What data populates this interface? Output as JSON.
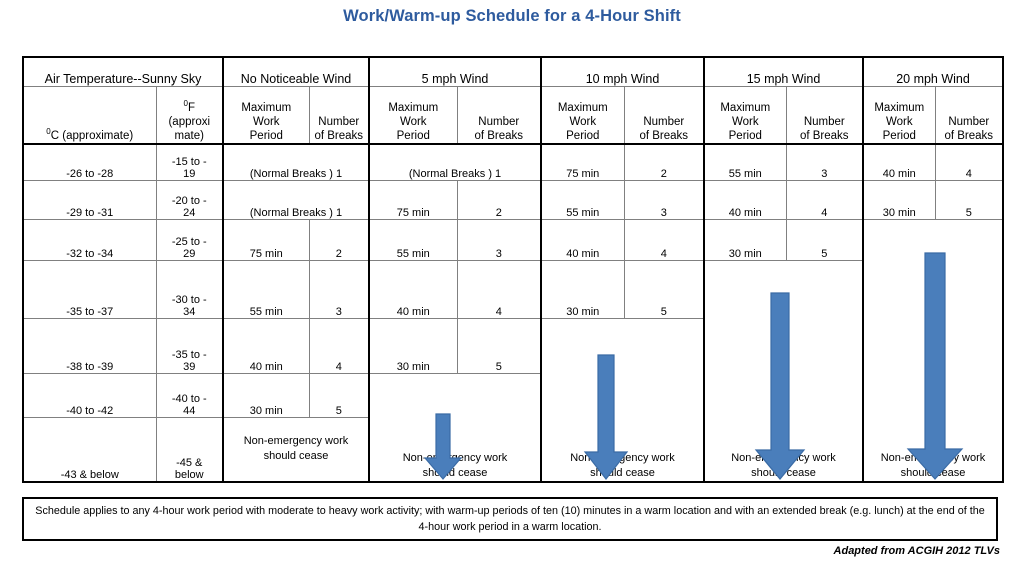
{
  "title": "Work/Warm-up Schedule for a 4-Hour Shift",
  "accent_color": "#2e5b9e",
  "arrow_color": "#4a7ebb",
  "arrow_border_color": "#3a6ba5",
  "table": {
    "group_headers": [
      "Air Temperature--Sunny Sky",
      "No Noticeable Wind",
      "5 mph Wind",
      "10 mph Wind",
      "15 mph Wind",
      "20 mph Wind"
    ],
    "sub_headers": {
      "celsius": "C (approximate)",
      "celsius_degree": "0",
      "fahrenheit_line1": "F",
      "fahrenheit_degree": "0",
      "fahrenheit_line2": "(approxi",
      "fahrenheit_line3": "mate)",
      "max_work_line1": "Maximum",
      "max_work_line2": "Work",
      "max_work_line3": "Period",
      "breaks_line1": "Number",
      "breaks_line2": "of Breaks"
    },
    "cease_text_line1": "Non-emergency work",
    "cease_text_line2": "should cease",
    "normal_breaks_text": "(Normal Breaks ) 1",
    "rows": [
      {
        "celsius": "-26 to -28",
        "fahrenheit_line1": "-15 to -",
        "fahrenheit_line2": "19",
        "no_wind": {
          "merged": true,
          "text": "(Normal Breaks ) 1"
        },
        "w5": {
          "merged": true,
          "text": "(Normal Breaks ) 1"
        },
        "w10": {
          "work": "75 min",
          "breaks": "2"
        },
        "w15": {
          "work": "55 min",
          "breaks": "3"
        },
        "w20": {
          "work": "40 min",
          "breaks": "4"
        }
      },
      {
        "celsius": "-29 to -31",
        "fahrenheit_line1": "-20 to -",
        "fahrenheit_line2": "24",
        "no_wind": {
          "merged": true,
          "text": "(Normal Breaks ) 1"
        },
        "w5": {
          "work": "75 min",
          "breaks": "2"
        },
        "w10": {
          "work": "55 min",
          "breaks": "3"
        },
        "w15": {
          "work": "40 min",
          "breaks": "4"
        },
        "w20": {
          "work": "30 min",
          "breaks": "5"
        }
      },
      {
        "celsius": "-32 to -34",
        "fahrenheit_line1": "-25 to -",
        "fahrenheit_line2": "29",
        "no_wind": {
          "work": "75 min",
          "breaks": "2"
        },
        "w5": {
          "work": "55 min",
          "breaks": "3"
        },
        "w10": {
          "work": "40 min",
          "breaks": "4"
        },
        "w15": {
          "work": "30 min",
          "breaks": "5"
        },
        "w20": {
          "cease": true
        }
      },
      {
        "celsius": "-35 to -37",
        "fahrenheit_line1": "-30 to -",
        "fahrenheit_line2": "34",
        "no_wind": {
          "work": "55 min",
          "breaks": "3"
        },
        "w5": {
          "work": "40 min",
          "breaks": "4"
        },
        "w10": {
          "work": "30 min",
          "breaks": "5"
        },
        "w15": {
          "cease": true
        },
        "w20": {
          "spanned": true
        }
      },
      {
        "celsius": "-38 to -39",
        "fahrenheit_line1": "-35 to -",
        "fahrenheit_line2": "39",
        "no_wind": {
          "work": "40 min",
          "breaks": "4"
        },
        "w5": {
          "work": "30 min",
          "breaks": "5"
        },
        "w10": {
          "cease": true
        },
        "w15": {
          "spanned": true
        },
        "w20": {
          "spanned": true
        }
      },
      {
        "celsius": "-40 to -42",
        "fahrenheit_line1": "-40 to -",
        "fahrenheit_line2": "44",
        "no_wind": {
          "work": "30 min",
          "breaks": "5"
        },
        "w5": {
          "cease": true
        },
        "w10": {
          "spanned": true
        },
        "w15": {
          "spanned": true
        },
        "w20": {
          "spanned": true
        }
      },
      {
        "celsius": "-43 & below",
        "fahrenheit_line1": "-45 &",
        "fahrenheit_line2": "below",
        "no_wind": {
          "cease": true
        },
        "w5": {
          "spanned": true
        },
        "w10": {
          "spanned": true
        },
        "w15": {
          "spanned": true
        },
        "w20": {
          "spanned": true
        }
      }
    ]
  },
  "footer": {
    "note": "Schedule applies to any 4-hour work period with moderate to heavy work activity; with warm-up periods of ten (10) minutes in a warm location and with an extended break (e.g. lunch) at the end of the 4-hour work period in a warm location.",
    "attribution": "Adapted from ACGIH 2012 TLVs"
  }
}
